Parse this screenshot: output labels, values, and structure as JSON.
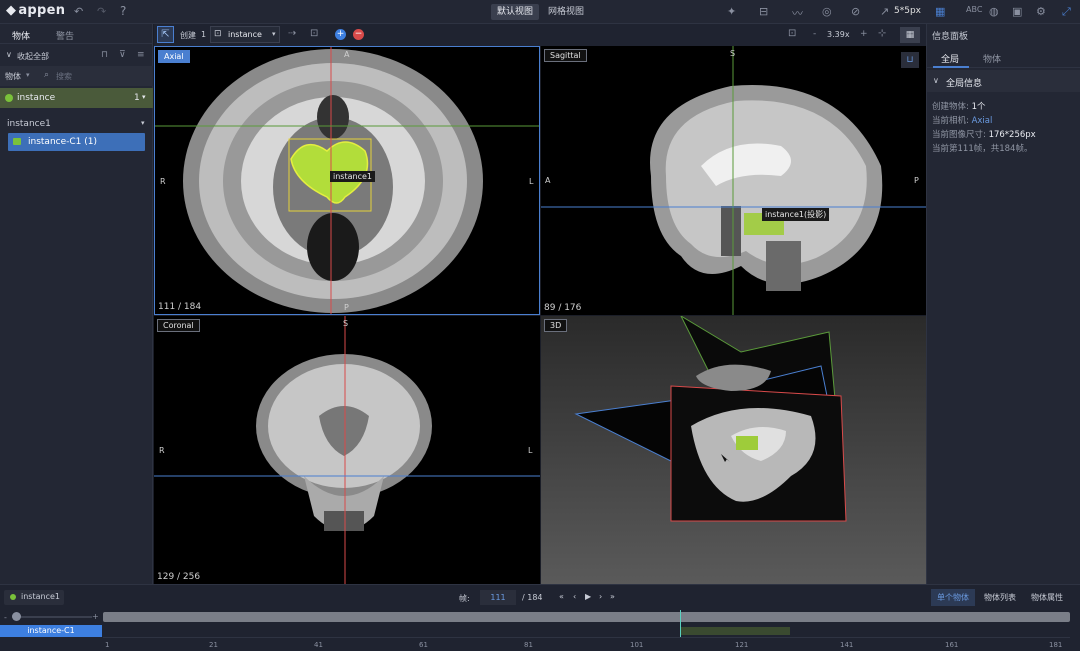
{
  "app": {
    "logo": "appen"
  },
  "header": {
    "view_tabs": [
      "默认视图",
      "网格视图"
    ],
    "brush_size": "5*5px"
  },
  "left": {
    "tabs": [
      "物体",
      "警告"
    ],
    "collapse_all": "收起全部",
    "filter_label": "物体",
    "search_placeholder": "搜索",
    "object_name": "instance",
    "object_count": "1",
    "group_name": "instance1",
    "instance_item": "instance-C1 (1)"
  },
  "toolbar": {
    "create_label": "创建",
    "create_count": "1",
    "class_select": "instance",
    "zoom": "3.39x",
    "minus": "-",
    "plus": "+"
  },
  "views": {
    "axial": {
      "label": "Axial",
      "frame": "111 / 184",
      "annotation": "instance1",
      "top": "A",
      "bottom": "P",
      "left": "R",
      "right": "L"
    },
    "sagittal": {
      "label": "Sagittal",
      "frame": "89 / 176",
      "annotation": "instance1(投影)",
      "top": "S",
      "left": "A",
      "right": "P"
    },
    "coronal": {
      "label": "Coronal",
      "frame": "129 / 256",
      "top": "S",
      "left": "R",
      "right": "L"
    },
    "three_d": {
      "label": "3D"
    }
  },
  "right": {
    "title": "信息面板",
    "tabs": [
      "全局",
      "物体"
    ],
    "section": "全局信息",
    "created_label": "创建物体:",
    "created_value": "1个",
    "camera_label": "当前相机:",
    "camera_value": "Axial",
    "size_label": "当前图像尺寸:",
    "size_value": "176*256px",
    "frame_info": "当前第111帧，共184帧。"
  },
  "bottom": {
    "chip": "instance1",
    "frame_label": "帧:",
    "frame_value": "111",
    "frame_total": "/ 184",
    "right_tabs": [
      "单个物体",
      "物体列表",
      "物体属性"
    ],
    "track_label": "instance-C1",
    "ticks": [
      "1",
      "21",
      "41",
      "61",
      "81",
      "101",
      "121",
      "141",
      "161",
      "181"
    ]
  },
  "colors": {
    "accent": "#4a7fd0",
    "green": "#7ac23a",
    "bg": "#1b1e28"
  }
}
